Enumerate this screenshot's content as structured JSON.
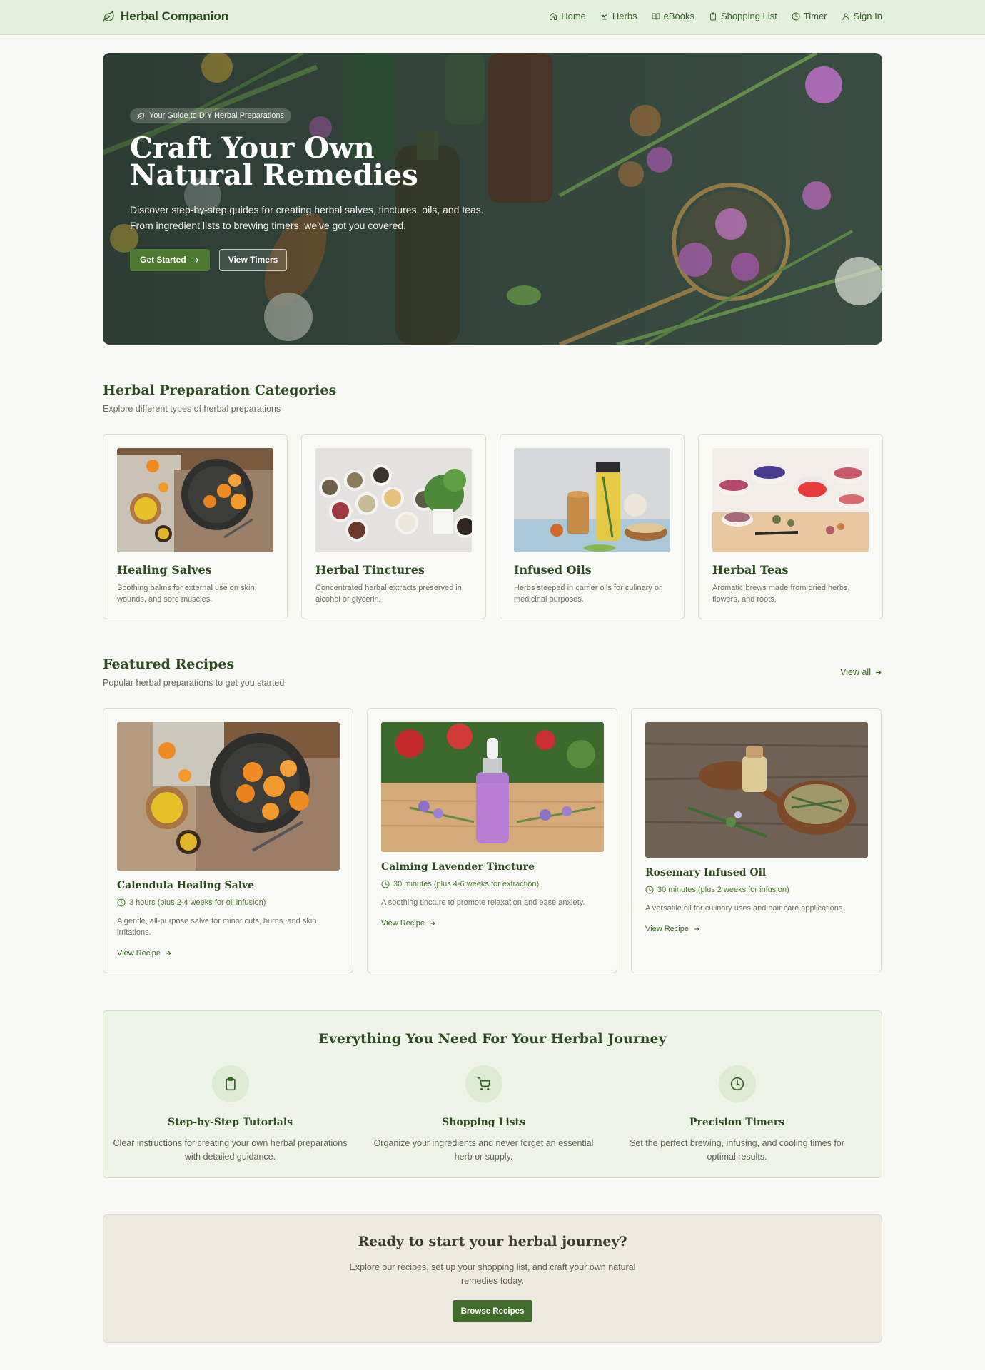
{
  "nav": {
    "brand": "Herbal Companion",
    "links": [
      {
        "label": "Home",
        "icon": "home-icon"
      },
      {
        "label": "Herbs",
        "icon": "sprout-icon"
      },
      {
        "label": "eBooks",
        "icon": "book-icon"
      },
      {
        "label": "Shopping List",
        "icon": "clipboard-icon"
      },
      {
        "label": "Timer",
        "icon": "clock-icon"
      },
      {
        "label": "Sign In",
        "icon": "user-icon"
      }
    ]
  },
  "hero": {
    "badge": "Your Guide to DIY Herbal Preparations",
    "title": "Craft Your Own Natural Remedies",
    "description": "Discover step-by-step guides for creating herbal salves, tinctures, oils, and teas. From ingredient lists to brewing timers, we've got you covered.",
    "primary_button": "Get Started",
    "secondary_button": "View Timers"
  },
  "categories": {
    "title": "Herbal Preparation Categories",
    "subtitle": "Explore different types of herbal preparations",
    "items": [
      {
        "title": "Healing Salves",
        "description": "Soothing balms for external use on skin, wounds, and sore muscles."
      },
      {
        "title": "Herbal Tinctures",
        "description": "Concentrated herbal extracts preserved in alcohol or glycerin."
      },
      {
        "title": "Infused Oils",
        "description": "Herbs steeped in carrier oils for culinary or medicinal purposes."
      },
      {
        "title": "Herbal Teas",
        "description": "Aromatic brews made from dried herbs, flowers, and roots."
      }
    ]
  },
  "recipes": {
    "title": "Featured Recipes",
    "subtitle": "Popular herbal preparations to get you started",
    "view_all": "View all",
    "items": [
      {
        "title": "Calendula Healing Salve",
        "time": "3 hours (plus 2-4 weeks for oil infusion)",
        "description": "A gentle, all-purpose salve for minor cuts, burns, and skin irritations.",
        "link": "View Recipe"
      },
      {
        "title": "Calming Lavender Tincture",
        "time": "30 minutes (plus 4-6 weeks for extraction)",
        "description": "A soothing tincture to promote relaxation and ease anxiety.",
        "link": "View Recipe"
      },
      {
        "title": "Rosemary Infused Oil",
        "time": "30 minutes (plus 2 weeks for infusion)",
        "description": "A versatile oil for culinary uses and hair care applications.",
        "link": "View Recipe"
      }
    ]
  },
  "features": {
    "title": "Everything You Need For Your Herbal Journey",
    "items": [
      {
        "title": "Step-by-Step Tutorials",
        "description": "Clear instructions for creating your own herbal preparations with detailed guidance.",
        "icon": "clipboard-icon"
      },
      {
        "title": "Shopping Lists",
        "description": "Organize your ingredients and never forget an essential herb or supply.",
        "icon": "cart-icon"
      },
      {
        "title": "Precision Timers",
        "description": "Set the perfect brewing, infusing, and cooling times for optimal results.",
        "icon": "clock-icon"
      }
    ]
  },
  "cta": {
    "title": "Ready to start your herbal journey?",
    "description": "Explore our recipes, set up your shopping list, and craft your own natural remedies today.",
    "button": "Browse Recipes"
  },
  "colors": {
    "accent": "#4c7a32",
    "heading": "#2e4a22",
    "nav_bg": "#e3f0dc",
    "cta_bg": "#efeae0"
  }
}
